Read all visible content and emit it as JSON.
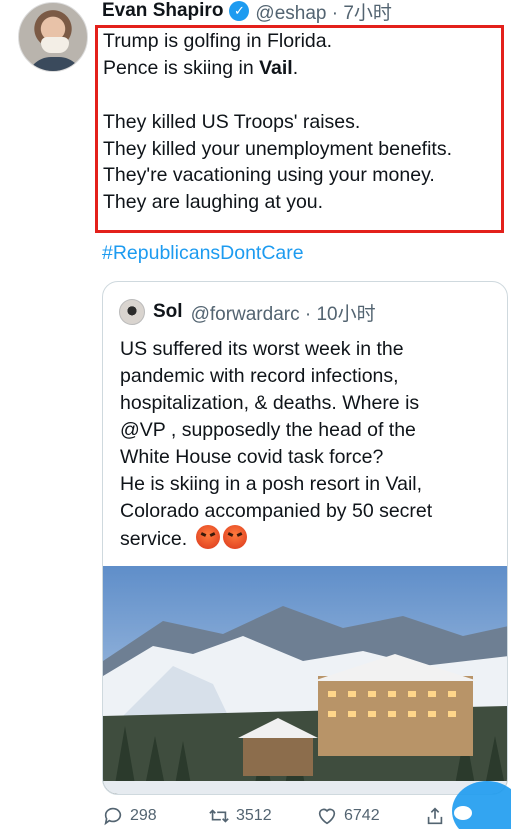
{
  "tweet": {
    "author_name": "Evan Shapiro",
    "verified": true,
    "handle_time": "@eshap · 7小时",
    "lines": [
      "Trump is golfing in Florida.",
      "Pence is skiing in ",
      "Vail",
      ".",
      "They killed US Troops' raises.",
      "They killed your unemployment benefits.",
      "They're vacationing using your money.",
      "They are laughing at you."
    ],
    "hashtag": "#RepublicansDontCare"
  },
  "quote": {
    "author_name": "Sol",
    "handle_time": "@forwardarc · 10小时",
    "lines": [
      "US suffered its worst week in the",
      "pandemic with record infections,",
      "hospitalization, & deaths. Where is",
      "@VP , supposedly the head of the",
      "White House covid task force?",
      "He is skiing in a posh resort in Vail,",
      "Colorado accompanied by 50 secret",
      "service."
    ],
    "emojis": [
      "angry-face",
      "angry-face"
    ],
    "image": "ski-resort-vail-photo"
  },
  "actions": {
    "replies": "298",
    "retweets": "3512",
    "likes": "6742"
  },
  "colors": {
    "highlight": "#e3201b",
    "link": "#1d9bf0",
    "secondary_text": "#536471"
  }
}
